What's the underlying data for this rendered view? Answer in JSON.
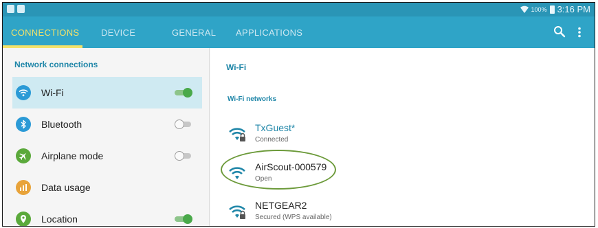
{
  "status_bar": {
    "battery": "100%",
    "time": "3:16 PM"
  },
  "tabs": [
    {
      "label": "CONNECTIONS",
      "active": true
    },
    {
      "label": "DEVICE",
      "active": false
    },
    {
      "label": "GENERAL",
      "active": false
    },
    {
      "label": "APPLICATIONS",
      "active": false
    }
  ],
  "toolbar": {
    "search_icon": "search-icon",
    "more_icon": "more-vert-icon"
  },
  "left_panel": {
    "title": "Network connections",
    "items": [
      {
        "label": "Wi-Fi",
        "icon": "wifi-icon",
        "color": "#2b9ad6",
        "toggle": "on",
        "selected": true
      },
      {
        "label": "Bluetooth",
        "icon": "bluetooth-icon",
        "color": "#2b9ad6",
        "toggle": "off",
        "selected": false
      },
      {
        "label": "Airplane mode",
        "icon": "airplane-icon",
        "color": "#5ba93b",
        "toggle": "off",
        "selected": false
      },
      {
        "label": "Data usage",
        "icon": "data-usage-icon",
        "color": "#e8a33a",
        "toggle": null,
        "selected": false
      },
      {
        "label": "Location",
        "icon": "location-icon",
        "color": "#5ba93b",
        "toggle": "on",
        "selected": false
      }
    ]
  },
  "right_panel": {
    "title": "Wi-Fi",
    "networks_title": "Wi-Fi networks",
    "networks": [
      {
        "name": "TxGuest*",
        "status": "Connected",
        "secured": true,
        "connected": true
      },
      {
        "name": "AirScout-000579",
        "status": "Open",
        "secured": false,
        "connected": false
      },
      {
        "name": "NETGEAR2",
        "status": "Secured (WPS available)",
        "secured": true,
        "connected": false
      }
    ]
  },
  "colors": {
    "accent": "#2fa4c7",
    "active_tab": "#f4e26a",
    "highlight_ring": "#6c9a3a"
  }
}
